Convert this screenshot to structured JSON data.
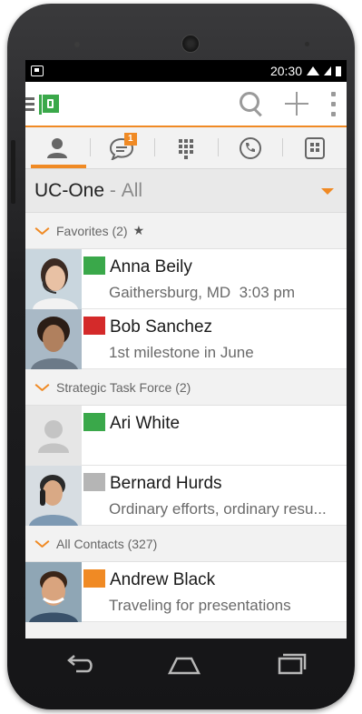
{
  "status_bar": {
    "time": "20:30"
  },
  "colors": {
    "accent": "#f08a24",
    "flag_green": "#3aa84a",
    "flag_red": "#d42a2a",
    "flag_gray": "#b5b5b5",
    "flag_orange": "#f08a24"
  },
  "app_bar": {
    "menu_icon": "hamburger-icon",
    "logo_icon": "green-flag-logo-icon",
    "actions": [
      "search-icon",
      "plus-icon",
      "overflow-menu-icon"
    ]
  },
  "tabs": [
    {
      "icon": "person-icon",
      "active": true
    },
    {
      "icon": "chat-icon",
      "badge": "1"
    },
    {
      "icon": "dialpad-icon"
    },
    {
      "icon": "call-history-icon"
    },
    {
      "icon": "directory-icon"
    }
  ],
  "group_selector": {
    "name": "UC-One",
    "separator": " - ",
    "filter": "All"
  },
  "sections": [
    {
      "title": "Favorites (2)",
      "icon": "star-icon",
      "contacts": [
        {
          "name": "Anna Beily",
          "status": "Gaithersburg, MD  3:03 pm",
          "flag": "green"
        },
        {
          "name": "Bob Sanchez",
          "status": "1st milestone in June",
          "flag": "red"
        }
      ]
    },
    {
      "title": "Strategic Task Force (2)",
      "contacts": [
        {
          "name": "Ari White",
          "status": "",
          "flag": "green"
        },
        {
          "name": "Bernard Hurds",
          "status": "Ordinary efforts, ordinary resu...",
          "flag": "gray"
        }
      ]
    },
    {
      "title": "All Contacts (327)",
      "contacts": [
        {
          "name": "Andrew Black",
          "status": "Traveling for presentations",
          "flag": "orange"
        }
      ]
    }
  ],
  "nav_bar": [
    "back-icon",
    "home-icon",
    "recents-icon"
  ]
}
